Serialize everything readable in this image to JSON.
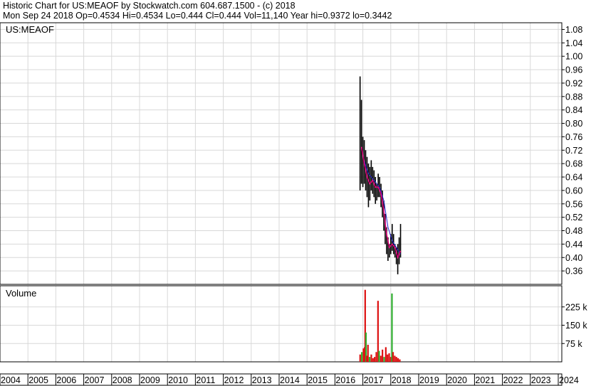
{
  "header": {
    "line1": "Historic Chart for US:MEAOF by Stockwatch.com 604.687.1500 - (c) 2018",
    "line2": "Mon Sep 24 2018   Op=0.4534   Hi=0.4534   Lo=0.444   Cl=0.444   Vol=11,140   Year hi=0.9372   lo=0.3442"
  },
  "price_panel": {
    "label": "US:MEAOF"
  },
  "volume_panel": {
    "label": "Volume"
  },
  "colors": {
    "grid": "#d8d8d8",
    "frame": "#000000",
    "price_bar": "#000000",
    "ma_short": "#e0007a",
    "ma_long": "#2020cc",
    "vol_up": "#30b030",
    "vol_down": "#dd1111"
  },
  "chart_data": [
    {
      "type": "line",
      "title": "US:MEAOF",
      "ylim": [
        0.32,
        1.1
      ],
      "y_ticks": [
        "1.08",
        "1.04",
        "1.00",
        "0.96",
        "0.92",
        "0.88",
        "0.84",
        "0.80",
        "0.76",
        "0.72",
        "0.68",
        "0.64",
        "0.60",
        "0.56",
        "0.52",
        "0.48",
        "0.44",
        "0.40",
        "0.36"
      ],
      "x_ticks": [
        "2004",
        "2005",
        "2006",
        "2007",
        "2008",
        "2009",
        "2010",
        "2011",
        "2012",
        "2013",
        "2014",
        "2015",
        "2016",
        "2017",
        "2018",
        "2019",
        "2020",
        "2021",
        "2022",
        "2023",
        "2024"
      ],
      "grid": true,
      "price_bars": [
        {
          "x": 2016.9,
          "high": 0.94,
          "low": 0.6
        },
        {
          "x": 2016.95,
          "high": 0.87,
          "low": 0.62
        },
        {
          "x": 2017.0,
          "high": 0.76,
          "low": 0.61
        },
        {
          "x": 2017.05,
          "high": 0.75,
          "low": 0.62
        },
        {
          "x": 2017.1,
          "high": 0.72,
          "low": 0.6
        },
        {
          "x": 2017.15,
          "high": 0.7,
          "low": 0.58
        },
        {
          "x": 2017.2,
          "high": 0.68,
          "low": 0.55
        },
        {
          "x": 2017.25,
          "high": 0.67,
          "low": 0.57
        },
        {
          "x": 2017.3,
          "high": 0.69,
          "low": 0.6
        },
        {
          "x": 2017.35,
          "high": 0.67,
          "low": 0.59
        },
        {
          "x": 2017.4,
          "high": 0.66,
          "low": 0.58
        },
        {
          "x": 2017.45,
          "high": 0.64,
          "low": 0.56
        },
        {
          "x": 2017.5,
          "high": 0.62,
          "low": 0.57
        },
        {
          "x": 2017.55,
          "high": 0.65,
          "low": 0.58
        },
        {
          "x": 2017.6,
          "high": 0.64,
          "low": 0.58
        },
        {
          "x": 2017.65,
          "high": 0.62,
          "low": 0.55
        },
        {
          "x": 2017.7,
          "high": 0.6,
          "low": 0.52
        },
        {
          "x": 2017.75,
          "high": 0.57,
          "low": 0.48
        },
        {
          "x": 2017.8,
          "high": 0.53,
          "low": 0.44
        },
        {
          "x": 2017.85,
          "high": 0.49,
          "low": 0.41
        },
        {
          "x": 2017.9,
          "high": 0.46,
          "low": 0.39
        },
        {
          "x": 2017.95,
          "high": 0.44,
          "low": 0.4
        },
        {
          "x": 2018.0,
          "high": 0.47,
          "low": 0.41
        },
        {
          "x": 2018.05,
          "high": 0.5,
          "low": 0.42
        },
        {
          "x": 2018.1,
          "high": 0.47,
          "low": 0.41
        },
        {
          "x": 2018.15,
          "high": 0.44,
          "low": 0.4
        },
        {
          "x": 2018.2,
          "high": 0.43,
          "low": 0.38
        },
        {
          "x": 2018.25,
          "high": 0.44,
          "low": 0.35
        },
        {
          "x": 2018.3,
          "high": 0.46,
          "low": 0.38
        },
        {
          "x": 2018.35,
          "high": 0.5,
          "low": 0.4
        }
      ],
      "ma_short": [
        [
          2016.95,
          0.73
        ],
        [
          2017.05,
          0.68
        ],
        [
          2017.15,
          0.64
        ],
        [
          2017.25,
          0.62
        ],
        [
          2017.35,
          0.63
        ],
        [
          2017.45,
          0.61
        ],
        [
          2017.55,
          0.61
        ],
        [
          2017.65,
          0.59
        ],
        [
          2017.75,
          0.54
        ],
        [
          2017.85,
          0.47
        ],
        [
          2017.95,
          0.43
        ],
        [
          2018.05,
          0.44
        ],
        [
          2018.15,
          0.43
        ],
        [
          2018.25,
          0.4
        ],
        [
          2018.35,
          0.42
        ]
      ],
      "ma_long": [
        [
          2017.0,
          0.7
        ],
        [
          2017.2,
          0.65
        ],
        [
          2017.4,
          0.63
        ],
        [
          2017.6,
          0.61
        ],
        [
          2017.75,
          0.57
        ],
        [
          2017.9,
          0.49
        ],
        [
          2018.05,
          0.45
        ],
        [
          2018.2,
          0.43
        ],
        [
          2018.35,
          0.41
        ]
      ]
    },
    {
      "type": "bar",
      "title": "Volume",
      "y_ticks": [
        "225 k",
        "150 k",
        "75 k"
      ],
      "ylim": [
        0,
        300
      ],
      "series": [
        {
          "values": [
            {
              "x": 2016.9,
              "v": 30,
              "up": false
            },
            {
              "x": 2016.96,
              "v": 40,
              "up": true
            },
            {
              "x": 2017.02,
              "v": 55,
              "up": false
            },
            {
              "x": 2017.06,
              "v": 60,
              "up": false
            },
            {
              "x": 2017.08,
              "v": 295,
              "up": false
            },
            {
              "x": 2017.11,
              "v": 120,
              "up": true
            },
            {
              "x": 2017.14,
              "v": 25,
              "up": false
            },
            {
              "x": 2017.18,
              "v": 70,
              "up": false
            },
            {
              "x": 2017.24,
              "v": 20,
              "up": true
            },
            {
              "x": 2017.3,
              "v": 30,
              "up": false
            },
            {
              "x": 2017.36,
              "v": 15,
              "up": false
            },
            {
              "x": 2017.42,
              "v": 20,
              "up": false
            },
            {
              "x": 2017.48,
              "v": 40,
              "up": false
            },
            {
              "x": 2017.54,
              "v": 250,
              "up": false
            },
            {
              "x": 2017.58,
              "v": 45,
              "up": true
            },
            {
              "x": 2017.64,
              "v": 25,
              "up": false
            },
            {
              "x": 2017.7,
              "v": 50,
              "up": false
            },
            {
              "x": 2017.76,
              "v": 20,
              "up": true
            },
            {
              "x": 2017.82,
              "v": 60,
              "up": false
            },
            {
              "x": 2017.88,
              "v": 30,
              "up": false
            },
            {
              "x": 2017.94,
              "v": 35,
              "up": false
            },
            {
              "x": 2018.0,
              "v": 20,
              "up": false
            },
            {
              "x": 2018.04,
              "v": 280,
              "up": true
            },
            {
              "x": 2018.08,
              "v": 40,
              "up": false
            },
            {
              "x": 2018.14,
              "v": 25,
              "up": false
            },
            {
              "x": 2018.2,
              "v": 20,
              "up": false
            },
            {
              "x": 2018.26,
              "v": 15,
              "up": false
            },
            {
              "x": 2018.32,
              "v": 10,
              "up": false
            }
          ]
        }
      ]
    }
  ]
}
